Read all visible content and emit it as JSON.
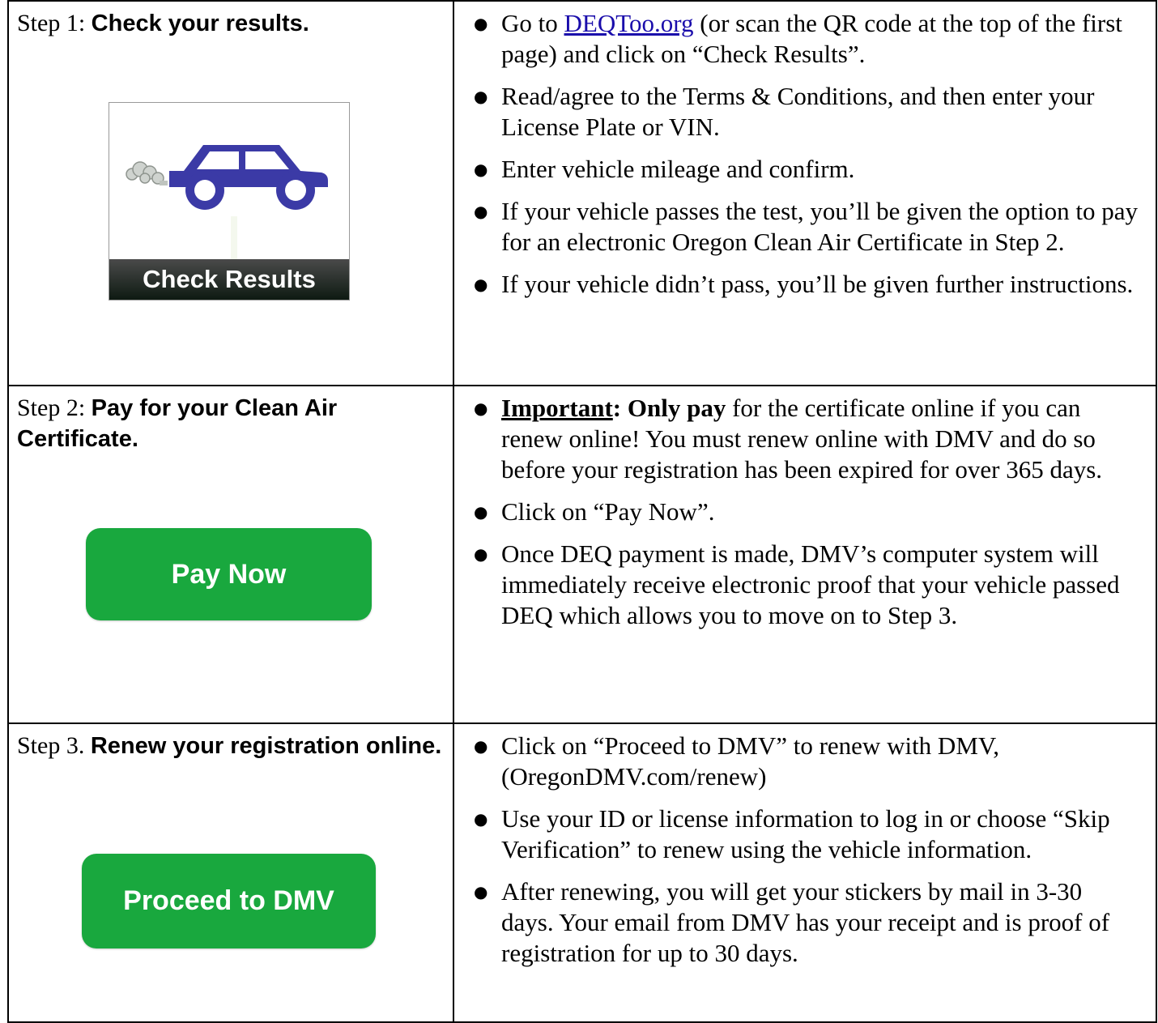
{
  "step1": {
    "prefix": "Step 1: ",
    "title": "Check your results.",
    "image_label": "Check Results",
    "bullets": {
      "b1_link": "DEQToo.org",
      "b1_rest": " (or scan the QR code at the top of the first page) and click on “Check Results”.",
      "b1_pre": "Go to ",
      "b2": "Read/agree to the Terms & Conditions, and then enter your License Plate or VIN.",
      "b3": "Enter vehicle mileage and confirm.",
      "b4": "If your vehicle passes the test, you’ll be given the option to pay for an electronic Oregon Clean Air Certificate in Step 2.",
      "b5": "If your vehicle didn’t pass, you’ll be given further instructions."
    }
  },
  "step2": {
    "prefix": "Step 2: ",
    "title": "Pay for your Clean Air Certificate.",
    "button_label": "Pay Now",
    "bullets": {
      "b1_important": "Important",
      "b1_colon": ": ",
      "b1_only": "Only pay",
      "b1_rest": " for the certificate online if you can renew online! You must renew online with DMV and do so before your registration has been expired for over 365 days.",
      "b2": "Click on “Pay Now”.",
      "b3": "Once DEQ payment is made, DMV’s computer system will immediately receive electronic proof that your vehicle passed DEQ which allows you to move on to Step 3."
    }
  },
  "step3": {
    "prefix": "Step 3. ",
    "title": "Renew your registration online.",
    "button_label": "Proceed to DMV",
    "bullets": {
      "b1": "Click on “Proceed to DMV” to renew with DMV, (OregonDMV.com/renew)",
      "b2": "Use your ID or license information to log in or choose “Skip Verification” to renew using the vehicle information.",
      "b3": "After renewing, you will get your stickers by mail in 3-30 days. Your email from DMV has your receipt and is proof of registration for up to 30 days."
    }
  },
  "bullet_glyph": "●",
  "colors": {
    "button_green": "#19a83e",
    "car_blue": "#3b3aa6",
    "link": "#1a0dab"
  }
}
